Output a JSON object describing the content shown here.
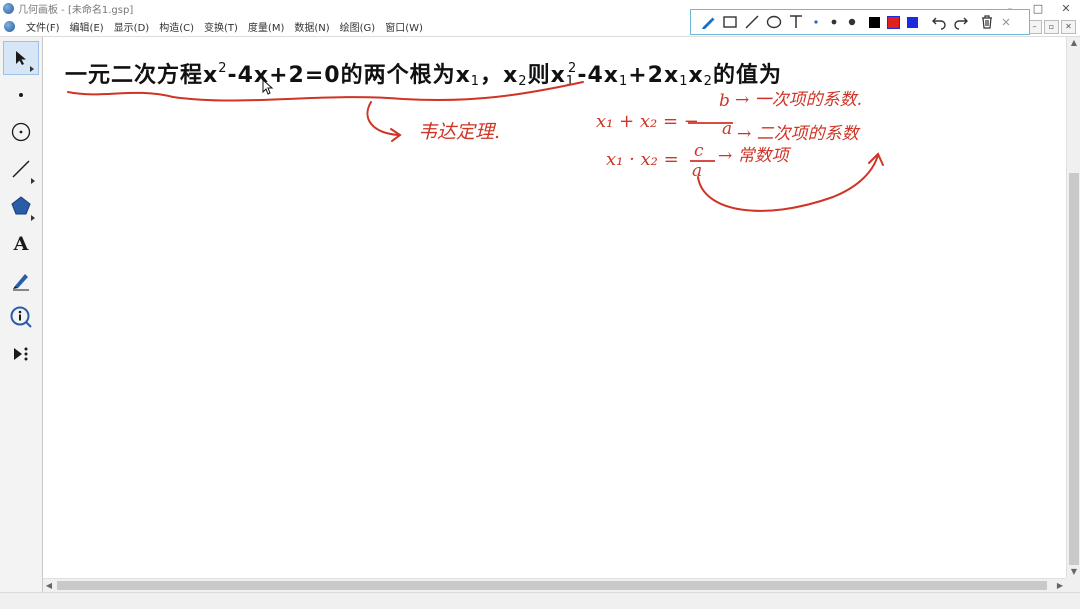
{
  "window": {
    "title": "几何画板 - [未命名1.gsp]",
    "controls": [
      "–",
      "□",
      "✕"
    ]
  },
  "menu": {
    "items": [
      "文件(F)",
      "编辑(E)",
      "显示(D)",
      "构造(C)",
      "变换(T)",
      "度量(M)",
      "数据(N)",
      "绘图(G)",
      "窗口(W)"
    ],
    "mdi_controls": [
      "–",
      "▫",
      "✕"
    ]
  },
  "drawbar": {
    "tools": [
      "pen-icon",
      "rectangle-icon",
      "line-icon",
      "ellipse-icon",
      "text-icon",
      "dot-small-icon",
      "dot-medium-icon",
      "dot-large-icon"
    ],
    "colors": [
      "#000000",
      "#e02020",
      "#1a2be0"
    ],
    "actions": [
      "undo-icon",
      "redo-icon",
      "trash-icon",
      "close-icon"
    ]
  },
  "toolbox": {
    "tools": [
      "arrow-select-icon",
      "point-icon",
      "compass-icon",
      "straightedge-icon",
      "polygon-icon",
      "text-tool-icon",
      "marker-icon",
      "info-icon",
      "custom-tool-icon"
    ]
  },
  "problem": {
    "text_a": "一元二次方程x",
    "sup_a": "2",
    "text_b": "-4x+2=0的两个根为x",
    "sub_a": "1",
    "text_c": "，x",
    "sub_b": "2",
    "text_d": "则x",
    "sub_c": "1",
    "sup_b": "2",
    "text_e": "-4x",
    "sub_d": "1",
    "text_f": "+2x",
    "sub_e": "1",
    "text_g": "x",
    "sub_f": "2",
    "text_h": "的值为"
  },
  "annotations": {
    "vieta": "韦达定理.",
    "sum": "x₁ + x₂ = −",
    "sum_num": "b",
    "sum_den": "a",
    "sum_note": "→ 一次项的系数.",
    "sum_den_note": "→ 二次项的系数",
    "product": "x₁ · x₂ =",
    "prod_num": "c",
    "prod_den": "a",
    "prod_note": "→ 常数项"
  },
  "colors": {
    "ink": "#cf3426",
    "toolbar_border": "#6fb6d8",
    "selected_tool": "#d6e6f7"
  }
}
